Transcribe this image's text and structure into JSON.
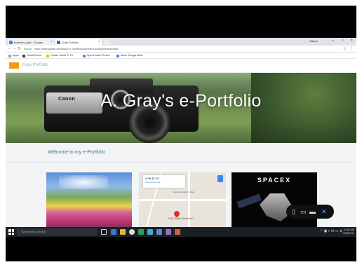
{
  "browser": {
    "tabs": [
      {
        "label": "bottomry-date - Google"
      },
      {
        "label": "Gray Portfolio"
      }
    ],
    "user": "Allison",
    "url": "https://sites.google.com/a/a/d/1Y..sf0f/BN/pc4d/H/dl/v/u4MMUBeaHg/0/edit",
    "secure_label": "Secure",
    "bookmarks": [
      {
        "label": "Apps"
      },
      {
        "label": "Grow/Techie"
      },
      {
        "label": "Create Grant Pt Fri"
      },
      {
        "label": "Spent Desk Photos"
      },
      {
        "label": "Move Google Note"
      }
    ]
  },
  "site": {
    "name": "Gray Portfolio",
    "hero_title": "A. Gray's e-Portfolio",
    "welcome": "Welcome to my e-Portfolio",
    "camera_brand": "Canon"
  },
  "map_card": {
    "info_title": "9 S8 $C-E1",
    "info_link": "View larger map",
    "pin_label": "9 S8 South Carolina 61",
    "map_label": "Cavendish Hall Sr Ross"
  },
  "spacex_card": {
    "logo": "SPACEX"
  },
  "taskbar": {
    "search_placeholder": "Type here to search",
    "time": "11:06 AM",
    "date": "8/23/2017"
  },
  "colors": {
    "accent": "#3c7a8a",
    "logo_orange": "#f39c12",
    "taskbar": "#1b2024"
  }
}
